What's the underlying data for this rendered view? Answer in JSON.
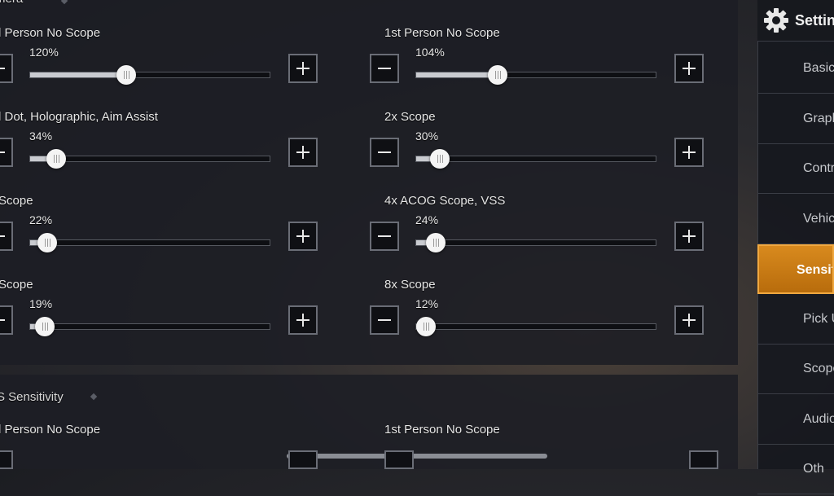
{
  "section1": {
    "title": "mera"
  },
  "section2": {
    "title": "S Sensitivity"
  },
  "sliders": [
    {
      "label": "l Person No Scope",
      "value": "120%",
      "level": 0.4
    },
    {
      "label": "1st Person No Scope",
      "value": "104%",
      "level": 0.34
    },
    {
      "label": "l Dot, Holographic, Aim Assist",
      "value": "34%",
      "level": 0.11
    },
    {
      "label": "2x Scope",
      "value": "30%",
      "level": 0.1
    },
    {
      "label": "Scope",
      "value": "22%",
      "level": 0.07
    },
    {
      "label": "4x ACOG Scope, VSS",
      "value": "24%",
      "level": 0.08
    },
    {
      "label": "Scope",
      "value": "19%",
      "level": 0.06
    },
    {
      "label": "8x Scope",
      "value": "12%",
      "level": 0.04
    }
  ],
  "section2_rows": [
    {
      "label": "l Person No Scope"
    },
    {
      "label": "1st Person No Scope"
    }
  ],
  "sidebar": {
    "title": "Setting",
    "items": [
      {
        "label": "Basic"
      },
      {
        "label": "Graphi"
      },
      {
        "label": "Contro"
      },
      {
        "label": "Vehicl"
      },
      {
        "label": "Sensitiv",
        "active": true
      },
      {
        "label": "Pick U"
      },
      {
        "label": "Scope"
      },
      {
        "label": "Audio"
      },
      {
        "label": "Oth"
      }
    ]
  },
  "colors": {
    "accent": "#d88a1e",
    "panel": "#1c1e24"
  }
}
